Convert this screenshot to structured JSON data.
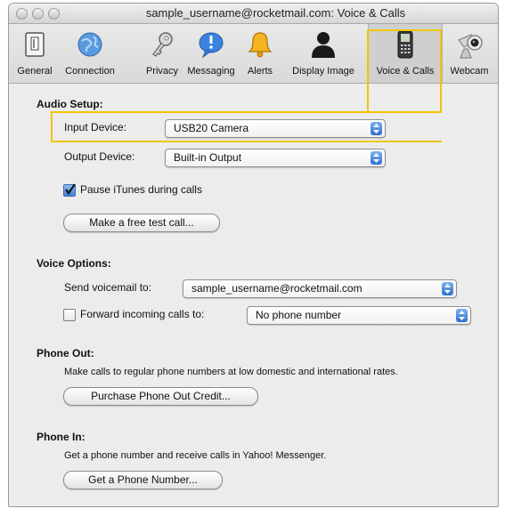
{
  "window": {
    "title": "sample_username@rocketmail.com: Voice & Calls"
  },
  "toolbar": {
    "items": [
      {
        "label": "General",
        "icon": "general-icon"
      },
      {
        "label": "Connection",
        "icon": "globe-icon"
      },
      {
        "label": "Privacy",
        "icon": "key-icon"
      },
      {
        "label": "Messaging",
        "icon": "speech-bubble-icon"
      },
      {
        "label": "Alerts",
        "icon": "bell-icon"
      },
      {
        "label": "Display Image",
        "icon": "person-silhouette-icon"
      },
      {
        "label": "Voice & Calls",
        "icon": "phone-icon",
        "selected": true
      },
      {
        "label": "Webcam",
        "icon": "webcam-icon"
      }
    ]
  },
  "audio_setup": {
    "heading": "Audio Setup:",
    "input_label": "Input Device:",
    "input_value": "USB20 Camera",
    "output_label": "Output Device:",
    "output_value": "Built-in Output",
    "pause_itunes_label": "Pause iTunes during calls",
    "pause_itunes_checked": true,
    "test_call_button": "Make a free test call..."
  },
  "voice_options": {
    "heading": "Voice Options:",
    "voicemail_label": "Send voicemail to:",
    "voicemail_value": "sample_username@rocketmail.com",
    "forward_label": "Forward incoming calls to:",
    "forward_checked": false,
    "forward_value": "No phone number"
  },
  "phone_out": {
    "heading": "Phone Out:",
    "description": "Make calls to regular phone numbers at low domestic and international rates.",
    "button": "Purchase Phone Out Credit..."
  },
  "phone_in": {
    "heading": "Phone In:",
    "description": "Get a phone number and receive calls in Yahoo! Messenger.",
    "button": "Get a Phone Number..."
  },
  "colors": {
    "highlight": "#f2c400",
    "accent": "#2d6fcf"
  }
}
